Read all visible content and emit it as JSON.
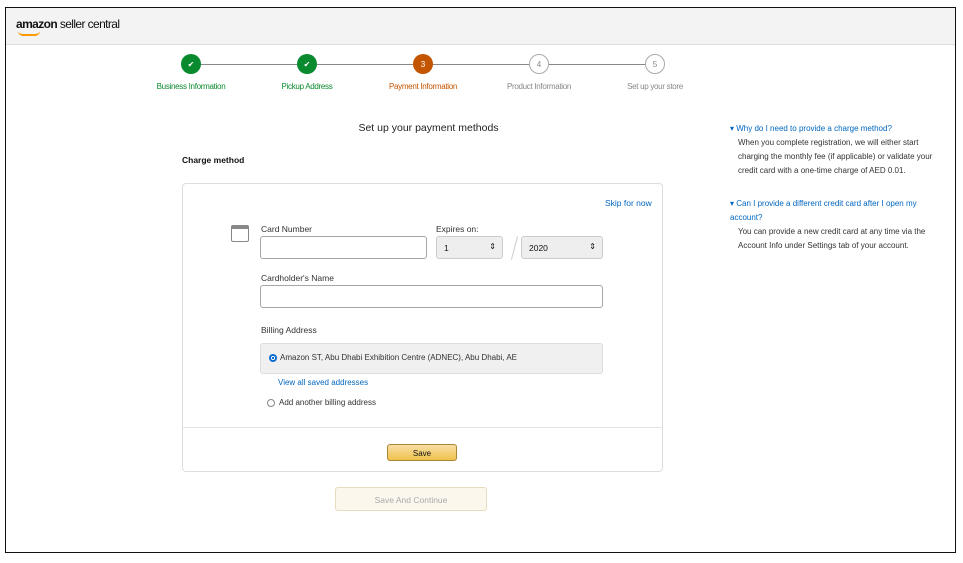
{
  "app": {
    "logo_brand": "amazon",
    "logo_product": "seller central"
  },
  "steps": [
    {
      "num": "1",
      "label": "Business Information",
      "state": "done"
    },
    {
      "num": "2",
      "label": "Pickup Address",
      "state": "done"
    },
    {
      "num": "3",
      "label": "Payment Information",
      "state": "current"
    },
    {
      "num": "4",
      "label": "Product Information",
      "state": "todo"
    },
    {
      "num": "5",
      "label": "Set up your store",
      "state": "todo"
    }
  ],
  "page_title": "Set up your payment methods",
  "charge_method_label": "Charge method",
  "form": {
    "skip": "Skip for now",
    "card_number_label": "Card Number",
    "card_number_value": "",
    "expires_label": "Expires on:",
    "month": "1",
    "year": "2020",
    "cardholder_label": "Cardholder's Name",
    "cardholder_value": "",
    "billing_label": "Billing Address",
    "address": "Amazon ST, Abu Dhabi Exhibition Centre (ADNEC), Abu Dhabi, AE",
    "view_all": "View all saved addresses",
    "add_another": "Add another billing address",
    "save": "Save"
  },
  "save_continue": "Save And Continue",
  "help": [
    {
      "q": "Why do I need to provide a charge method?",
      "a": "When you complete registration, we will either start charging the monthly fee (if applicable) or validate your credit card with a one-time charge of AED 0.01."
    },
    {
      "q": "Can I provide a different credit card after I open my account?",
      "a": "You can provide a new credit card at any time via the Account Info under Settings tab of your account."
    }
  ],
  "colors": {
    "done": "#0a8a2e",
    "current": "#c45500",
    "link": "#0066c0"
  }
}
